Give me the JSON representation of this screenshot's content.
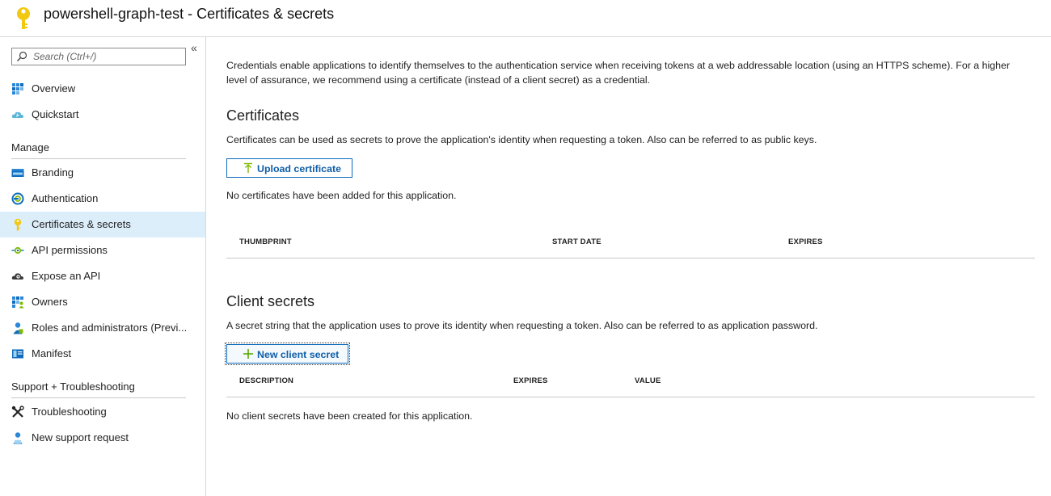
{
  "header": {
    "title": "powershell-graph-test - Certificates & secrets"
  },
  "sidebar": {
    "collapse_label": "«",
    "search": {
      "placeholder": "Search (Ctrl+/)",
      "value": ""
    },
    "items_top": [
      {
        "label": "Overview",
        "icon": "overview-grid-icon"
      },
      {
        "label": "Quickstart",
        "icon": "cloud-icon"
      }
    ],
    "manage_header": "Manage",
    "manage_items": [
      {
        "label": "Branding",
        "icon": "branding-icon"
      },
      {
        "label": "Authentication",
        "icon": "authentication-icon"
      },
      {
        "label": "Certificates & secrets",
        "icon": "key-icon",
        "selected": true
      },
      {
        "label": "API permissions",
        "icon": "api-permissions-icon"
      },
      {
        "label": "Expose an API",
        "icon": "cloud-gear-icon"
      },
      {
        "label": "Owners",
        "icon": "owners-grid-icon"
      },
      {
        "label": "Roles and administrators (Previ...",
        "icon": "user-badge-icon"
      },
      {
        "label": "Manifest",
        "icon": "manifest-icon"
      }
    ],
    "support_header": "Support + Troubleshooting",
    "support_items": [
      {
        "label": "Troubleshooting",
        "icon": "wrench-icon"
      },
      {
        "label": "New support request",
        "icon": "support-person-icon"
      }
    ]
  },
  "main": {
    "intro": "Credentials enable applications to identify themselves to the authentication service when receiving tokens at a web addressable location (using an HTTPS scheme). For a higher level of assurance, we recommend using a certificate (instead of a client secret) as a credential.",
    "certificates": {
      "title": "Certificates",
      "description": "Certificates can be used as secrets to prove the application's identity when requesting a token. Also can be referred to as public keys.",
      "upload_label": "Upload certificate",
      "empty_message": "No certificates have been added for this application.",
      "columns": [
        "THUMBPRINT",
        "START DATE",
        "EXPIRES"
      ]
    },
    "client_secrets": {
      "title": "Client secrets",
      "description": "A secret string that the application uses to prove its identity when requesting a token. Also can be referred to as application password.",
      "new_label": "New client secret",
      "empty_message": "No client secrets have been created for this application.",
      "columns": [
        "DESCRIPTION",
        "EXPIRES",
        "VALUE"
      ]
    }
  },
  "colors": {
    "accent": "#0f6cbd",
    "selected_bg": "#ddeefb",
    "key_yellow": "#f2c811"
  }
}
